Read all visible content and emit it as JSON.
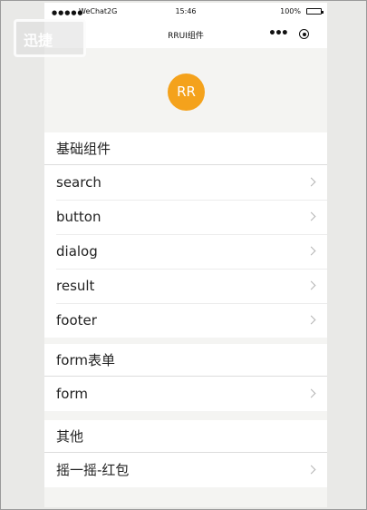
{
  "status_bar": {
    "signal": "●●●●●",
    "carrier": "WeChat2G",
    "time": "15:46",
    "battery": "100%"
  },
  "nav": {
    "title": "RRUI组件",
    "more_icon": "more-dots-icon",
    "close_icon": "circle-close-icon"
  },
  "watermark": "迅捷",
  "avatar": {
    "initials": "RR",
    "color": "#f4a21c"
  },
  "groups": [
    {
      "title": "基础组件",
      "items": [
        "search",
        "button",
        "dialog",
        "result",
        "footer"
      ]
    },
    {
      "title": "form表单",
      "items": [
        "form"
      ]
    },
    {
      "title": "其他",
      "items": [
        "摇一摇-红包"
      ]
    }
  ]
}
